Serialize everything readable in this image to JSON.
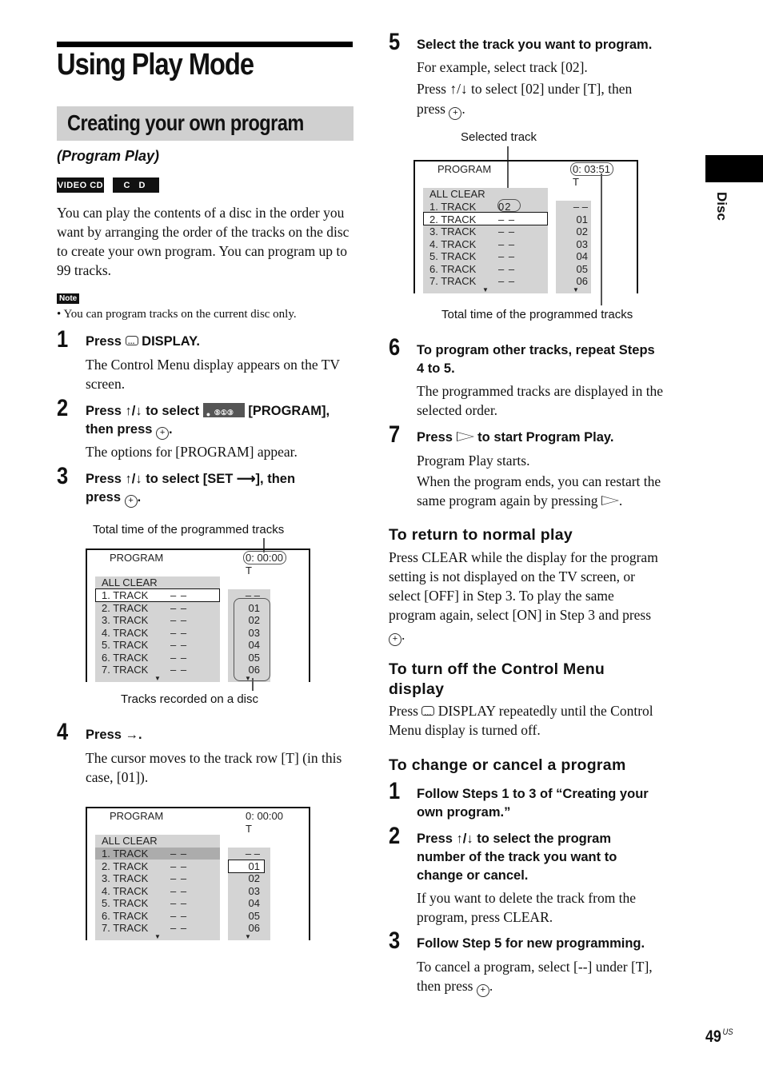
{
  "page": {
    "title": "Using Play Mode",
    "section_title": "Creating your own program",
    "subtitle": "(Program Play)",
    "badges": [
      "VIDEO CD",
      "C D"
    ],
    "intro": "You can play the contents of a disc in the order you want by arranging the order of the tracks on the disc to create your own program. You can program up to 99 tracks.",
    "note_label": "Note",
    "note_text": "• You can program tracks on the current disc only.",
    "side_tab": "Disc",
    "page_number": "49",
    "page_suffix": "US"
  },
  "icons": {
    "enter": "circle-plus-enter-icon",
    "display": "display-button-icon",
    "updown": "↑/↓",
    "right": "→",
    "play": "play-triangle-icon",
    "program_menu": "program-menu-icon"
  },
  "steps": [
    {
      "num": "1",
      "head_pre": "Press",
      "head_post": "DISPLAY.",
      "body": [
        "The Control Menu display appears on the TV screen."
      ]
    },
    {
      "num": "2",
      "head_pre": "Press ↑/↓ to select",
      "head_mid": "[PROGRAM],",
      "head_post": "then press",
      "body": [
        "The options for [PROGRAM] appear."
      ]
    },
    {
      "num": "3",
      "head_pre": "Press ↑/↓ to select [SET ⟶], then",
      "head_post": "press",
      "body": []
    },
    {
      "num": "4",
      "head_pre": "Press →.",
      "body": [
        "The cursor moves to the track row [T] (in this case, [01])."
      ]
    },
    {
      "num": "5",
      "head_pre": "Select the track you want to program.",
      "body": [
        "For example, select track [02].",
        "Press ↑/↓ to select [02] under [T], then",
        "press"
      ]
    },
    {
      "num": "6",
      "head_pre": "To program other tracks, repeat Steps",
      "head_post": "4 to 5.",
      "body": [
        "The programmed tracks are displayed in the",
        "selected order."
      ]
    },
    {
      "num": "7",
      "head_pre": "Press",
      "head_post": "to start Program Play.",
      "body": [
        "Program Play starts.",
        "When the program ends, you can restart the",
        "same program again by pressing"
      ]
    }
  ],
  "screens": [
    {
      "title": "PROGRAM",
      "time": "0: 00:00",
      "t_label": "T",
      "all_clear": "ALL CLEAR",
      "tracks": [
        "1. TRACK",
        "2. TRACK",
        "3. TRACK",
        "4. TRACK",
        "5. TRACK",
        "6. TRACK",
        "7. TRACK"
      ],
      "track_values": [
        "– –",
        "– –",
        "– –",
        "– –",
        "– –",
        "– –",
        "– –"
      ],
      "t_values": [
        "– –",
        "01",
        "02",
        "03",
        "04",
        "05",
        "06"
      ],
      "callout_top": "Total time of the programmed tracks",
      "callout_bottom": "Tracks recorded on a disc"
    },
    {
      "title": "PROGRAM",
      "time": "0: 00:00",
      "t_label": "T",
      "all_clear": "ALL CLEAR",
      "tracks": [
        "1. TRACK",
        "2. TRACK",
        "3. TRACK",
        "4. TRACK",
        "5. TRACK",
        "6. TRACK",
        "7. TRACK"
      ],
      "track_values": [
        "– –",
        "– –",
        "– –",
        "– –",
        "– –",
        "– –",
        "– –"
      ],
      "t_values": [
        "– –",
        "01",
        "02",
        "03",
        "04",
        "05",
        "06"
      ]
    },
    {
      "title": "PROGRAM",
      "time": "0: 03:51",
      "t_label": "T",
      "all_clear": "ALL CLEAR",
      "tracks": [
        "1. TRACK",
        "2. TRACK",
        "3. TRACK",
        "4. TRACK",
        "5. TRACK",
        "6. TRACK",
        "7. TRACK"
      ],
      "track_values": [
        "02",
        "– –",
        "– –",
        "– –",
        "– –",
        "– –",
        "– –"
      ],
      "t_values": [
        "– –",
        "01",
        "02",
        "03",
        "04",
        "05",
        "06"
      ],
      "callout_top": "Selected track",
      "callout_bottom": "Total time of the programmed tracks"
    }
  ],
  "return_normal": {
    "heading": "To return to normal play",
    "lines": [
      "Press CLEAR while the display for the program",
      "setting is not displayed on the TV screen, or",
      "select [OFF] in Step 3. To play the same",
      "program again, select [ON] in Step 3 and press"
    ]
  },
  "turn_off": {
    "heading_1": "To turn off the Control Menu",
    "heading_2": "display",
    "line_1_pre": "Press",
    "line_1_post": "DISPLAY repeatedly until the Control",
    "line_2": "Menu display is turned off."
  },
  "change_cancel": {
    "heading": "To change or cancel a program",
    "steps": [
      {
        "num": "1",
        "head": [
          "Follow Steps 1 to 3 of “Creating your",
          "own program.”"
        ],
        "body": []
      },
      {
        "num": "2",
        "head": [
          "Press ↑/↓ to select the program",
          "number of the track you want to",
          "change or cancel."
        ],
        "body": [
          "If you want to delete the track from the",
          "program, press CLEAR."
        ]
      },
      {
        "num": "3",
        "head": [
          "Follow Step 5 for new programming."
        ],
        "body": [
          "To cancel a program, select [--] under [T],",
          "then press"
        ]
      }
    ]
  }
}
